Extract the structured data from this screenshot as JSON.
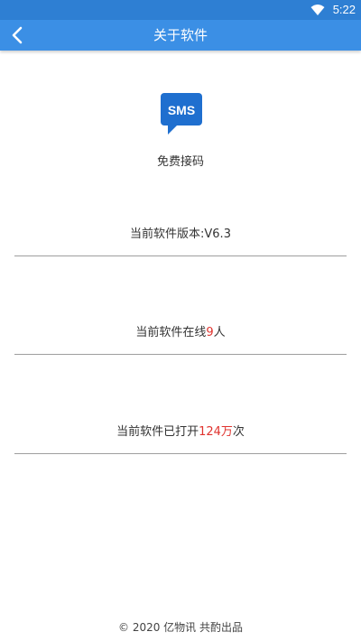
{
  "status_bar": {
    "time": "5:22",
    "wifi_icon": "wifi-icon"
  },
  "app_bar": {
    "title": "关于软件",
    "back_icon": "chevron-left-icon",
    "color": "#3b8fe5"
  },
  "about": {
    "logo_text": "SMS",
    "logo_icon": "sms-chat-bubble-icon",
    "app_name": "免费接码",
    "version_text": "当前软件版本:V6.3",
    "online": {
      "prefix": "当前软件在线",
      "count": "9",
      "suffix": "人"
    },
    "opened": {
      "prefix": "当前软件已打开",
      "count": "124万",
      "suffix": "次"
    }
  },
  "colors": {
    "highlight": "#e0332e",
    "text": "#333333"
  },
  "footer": {
    "copyright": "© 2020 亿物讯 共酌出品"
  }
}
